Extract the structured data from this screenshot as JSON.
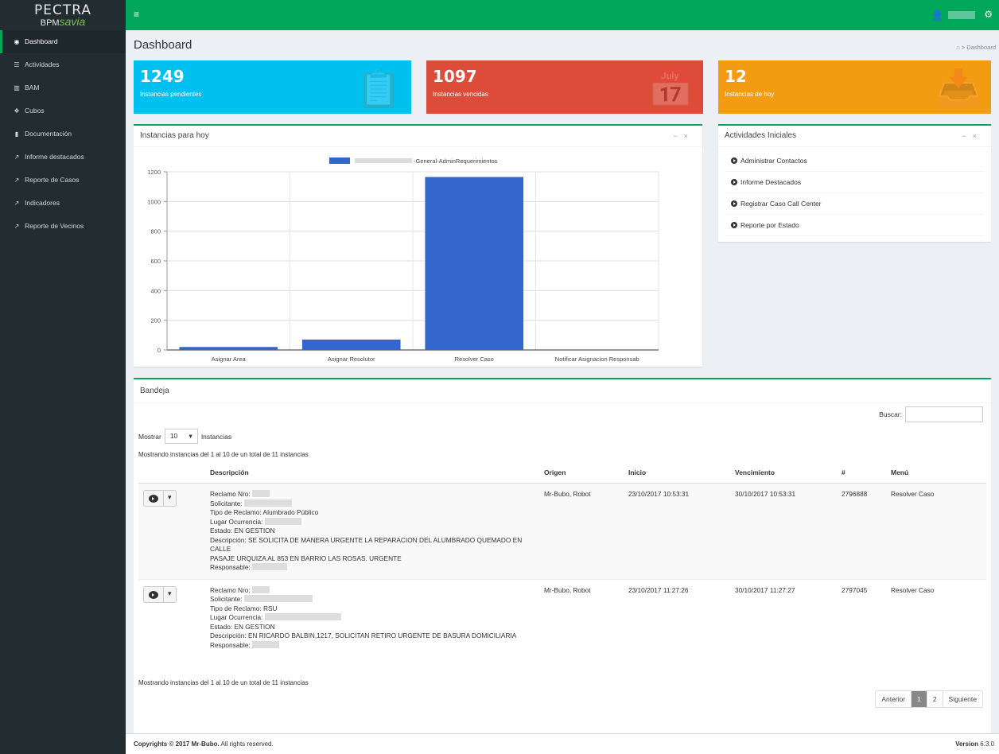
{
  "brand": {
    "line1": "PECTRA",
    "line2a": "BPM",
    "line2b": "savia"
  },
  "sidebar": {
    "items": [
      {
        "label": "Dashboard",
        "icon": "dashboard-icon",
        "glyph": "◉"
      },
      {
        "label": "Actividades",
        "icon": "list-icon",
        "glyph": "☰"
      },
      {
        "label": "BAM",
        "icon": "bar-chart-icon",
        "glyph": "▥"
      },
      {
        "label": "Cubos",
        "icon": "cubes-icon",
        "glyph": "❖"
      },
      {
        "label": "Documentación",
        "icon": "book-icon",
        "glyph": "▮"
      },
      {
        "label": "Informe destacados",
        "icon": "external-link-icon",
        "glyph": "↗"
      },
      {
        "label": "Reporte de Casos",
        "icon": "external-link-icon",
        "glyph": "↗"
      },
      {
        "label": "Indicadores",
        "icon": "external-link-icon",
        "glyph": "↗"
      },
      {
        "label": "Reporte de Vecinos",
        "icon": "external-link-icon",
        "glyph": "↗"
      }
    ]
  },
  "header": {
    "title": "Dashboard",
    "breadcrumb": "Dashboard"
  },
  "stats": [
    {
      "value": "1249",
      "label": "Instancias pendientes",
      "color": "#00c0ef",
      "icon": "clipboard-icon",
      "glyph": "📋"
    },
    {
      "value": "1097",
      "label": "Instancias vencidas",
      "color": "#dd4b39",
      "icon": "calendar-icon",
      "glyph": "📅"
    },
    {
      "value": "12",
      "label": "Instancias de hoy",
      "color": "#f39c12",
      "icon": "download-icon",
      "glyph": "📥"
    }
  ],
  "chart_box": {
    "title": "Instancias para hoy"
  },
  "chart_data": {
    "type": "bar",
    "categories": [
      "Asignar Area",
      "Asignar Resolutor",
      "Resolver Caso",
      "Notificar Asignacion Responsab"
    ],
    "series": [
      {
        "name": "-General-AdminRequerimientos",
        "values": [
          20,
          70,
          1165,
          0
        ],
        "color": "#3366cc"
      }
    ],
    "ylim": [
      0,
      1200
    ],
    "yticks": [
      0,
      200,
      400,
      600,
      800,
      1000,
      1200
    ],
    "grid": true,
    "legend": "top"
  },
  "activities": {
    "title": "Actividades Iniciales",
    "items": [
      "Administrar Contactos",
      "Informe Destacados",
      "Registrar Caso Call Center",
      "Reporte por Estado"
    ]
  },
  "bandeja": {
    "title": "Bandeja",
    "search_label": "Buscar:",
    "show_label": "Mostrar",
    "show_value": "10",
    "show_suffix": "Instancias",
    "info": "Mostrando instancias del 1 al 10 de un total de 11 instancias",
    "columns": [
      "Descripción",
      "Origen",
      "Inicio",
      "Vencimiento",
      "#",
      "Menú"
    ],
    "rows": [
      {
        "lines": [
          "Reclamo Nro:",
          "Solicitante:",
          "Tipo de Reclamo: Alumbrado Público",
          "Lugar Ocurrencia:",
          "Estado: EN GESTION",
          "Descripción: SE SOLICITA DE MANERA URGENTE LA REPARACION DEL ALUMBRADO QUEMADO EN CALLE",
          "PASAJE URQUIZA AL 853 EN BARRIO LAS ROSAS. URGENTE",
          "Responsable:"
        ],
        "origen": "Mr-Bubo, Robot",
        "inicio": "23/10/2017 10:53:31",
        "vencimiento": "30/10/2017 10:53:31",
        "num": "2796888",
        "menu": "Resolver Caso"
      },
      {
        "lines": [
          "Reclamo Nro:",
          "Solicitante:",
          "Tipo de Reclamo: RSU",
          "Lugar Ocurrencia:",
          "Estado: EN GESTION",
          "Descripción: EN RICARDO BALBIN,1217, SOLICITAN RETIRO URGENTE DE BASURA DOMICILIARIA",
          "Responsable:"
        ],
        "origen": "Mr-Bubo, Robot",
        "inicio": "23/10/2017 11:27:26",
        "vencimiento": "30/10/2017 11:27:27",
        "num": "2797045",
        "menu": "Resolver Caso"
      }
    ],
    "pager": [
      "Anterior",
      "1",
      "2",
      "Siguiente"
    ]
  },
  "footer": {
    "copy_a": "Copyrights © 2017 ",
    "copy_b": "Mr-Bubo.",
    "copy_c": " All rights reserved.",
    "ver_a": "Version",
    "ver_b": " 6.3.0"
  }
}
